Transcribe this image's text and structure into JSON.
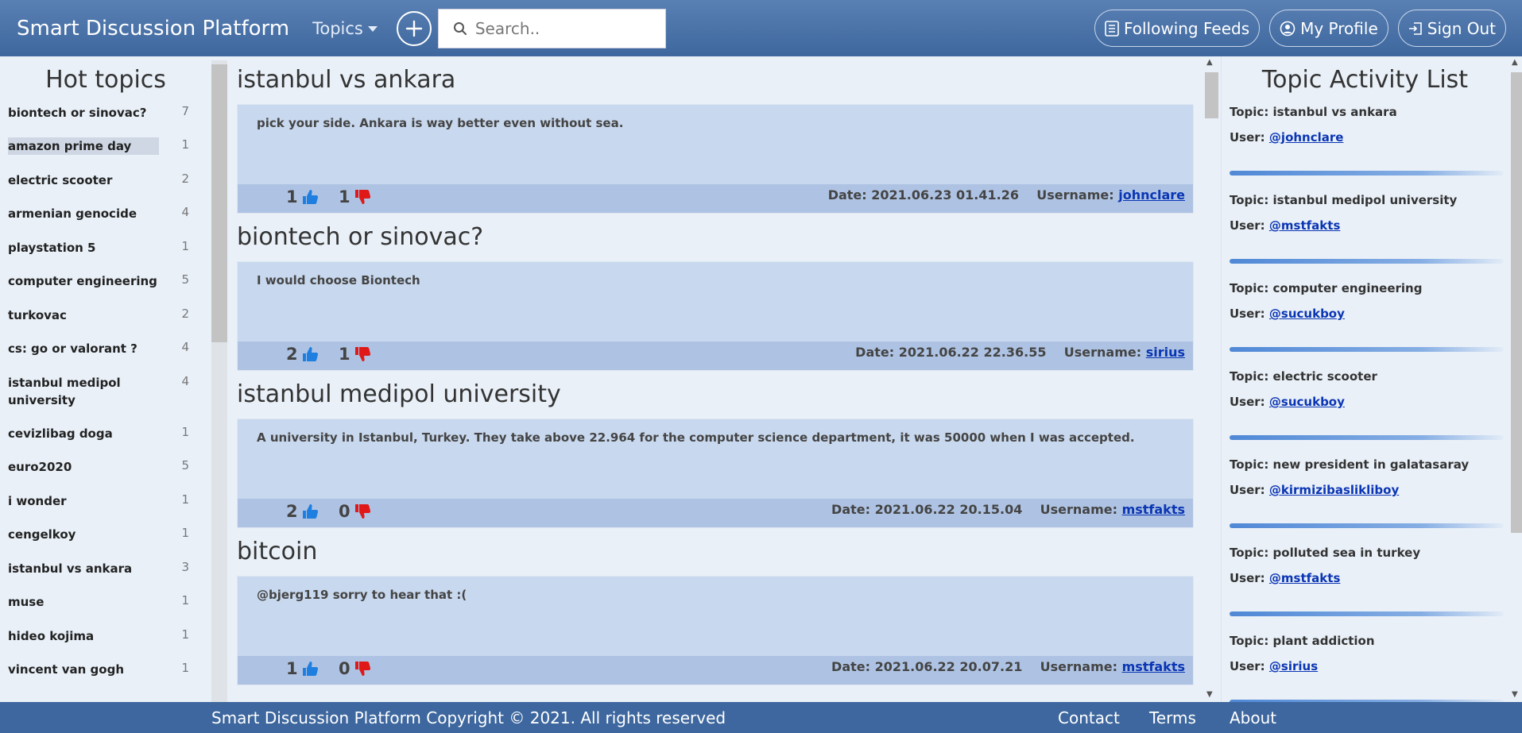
{
  "header": {
    "brand": "Smart Discussion Platform",
    "topics_label": "Topics",
    "search_placeholder": "Search..",
    "following_label": "Following Feeds",
    "profile_label": "My Profile",
    "signout_label": "Sign Out"
  },
  "hot_topics": {
    "title": "Hot topics",
    "items": [
      {
        "name": "biontech or sinovac?",
        "count": "7"
      },
      {
        "name": "amazon prime day",
        "count": "1"
      },
      {
        "name": "electric scooter",
        "count": "2"
      },
      {
        "name": "armenian genocide",
        "count": "4"
      },
      {
        "name": "playstation 5",
        "count": "1"
      },
      {
        "name": "computer engineering",
        "count": "5"
      },
      {
        "name": "turkovac",
        "count": "2"
      },
      {
        "name": "cs: go or valorant ?",
        "count": "4"
      },
      {
        "name": "istanbul medipol university",
        "count": "4"
      },
      {
        "name": "cevizlibag doga",
        "count": "1"
      },
      {
        "name": "euro2020",
        "count": "5"
      },
      {
        "name": "i wonder",
        "count": "1"
      },
      {
        "name": "cengelkoy",
        "count": "1"
      },
      {
        "name": "istanbul vs ankara",
        "count": "3"
      },
      {
        "name": "muse",
        "count": "1"
      },
      {
        "name": "hideo kojima",
        "count": "1"
      },
      {
        "name": "vincent van gogh",
        "count": "1"
      }
    ]
  },
  "posts": [
    {
      "title": "istanbul vs ankara",
      "body": "pick your side. Ankara is way better even without sea.",
      "likes": "1",
      "dislikes": "1",
      "date": "Date: 2021.06.23 01.41.26",
      "username_label": "Username:",
      "username": "johnclare"
    },
    {
      "title": "biontech or sinovac?",
      "body": "I would choose Biontech",
      "likes": "2",
      "dislikes": "1",
      "date": "Date: 2021.06.22 22.36.55",
      "username_label": "Username:",
      "username": "sirius"
    },
    {
      "title": "istanbul medipol university",
      "body": "A university in Istanbul, Turkey. They take above 22.964 for the computer science department, it was 50000 when I was accepted.",
      "likes": "2",
      "dislikes": "0",
      "date": "Date: 2021.06.22 20.15.04",
      "username_label": "Username:",
      "username": "mstfakts"
    },
    {
      "title": "bitcoin",
      "body": "@bjerg119 sorry to hear that :(",
      "likes": "1",
      "dislikes": "0",
      "date": "Date: 2021.06.22 20.07.21",
      "username_label": "Username:",
      "username": "mstfakts"
    }
  ],
  "activity": {
    "title": "Topic Activity List",
    "items": [
      {
        "topic": "Topic: istanbul vs ankara",
        "user_label": "User:",
        "user": "@johnclare"
      },
      {
        "topic": "Topic: istanbul medipol university",
        "user_label": "User:",
        "user": "@mstfakts"
      },
      {
        "topic": "Topic: computer engineering",
        "user_label": "User:",
        "user": "@sucukboy"
      },
      {
        "topic": "Topic: electric scooter",
        "user_label": "User:",
        "user": "@sucukboy"
      },
      {
        "topic": "Topic: new president in galatasaray",
        "user_label": "User:",
        "user": "@kirmizibaslikliboy"
      },
      {
        "topic": "Topic: polluted sea in turkey",
        "user_label": "User:",
        "user": "@mstfakts"
      },
      {
        "topic": "Topic: plant addiction",
        "user_label": "User:",
        "user": "@sirius"
      }
    ]
  },
  "footer": {
    "copyright": "Smart Discussion Platform Copyright © 2021. All rights reserved",
    "contact": "Contact",
    "terms": "Terms",
    "about": "About"
  },
  "colors": {
    "header": "#3d679e",
    "like": "#1e7fe0",
    "dislike": "#e01818",
    "link": "#0a35b4"
  }
}
